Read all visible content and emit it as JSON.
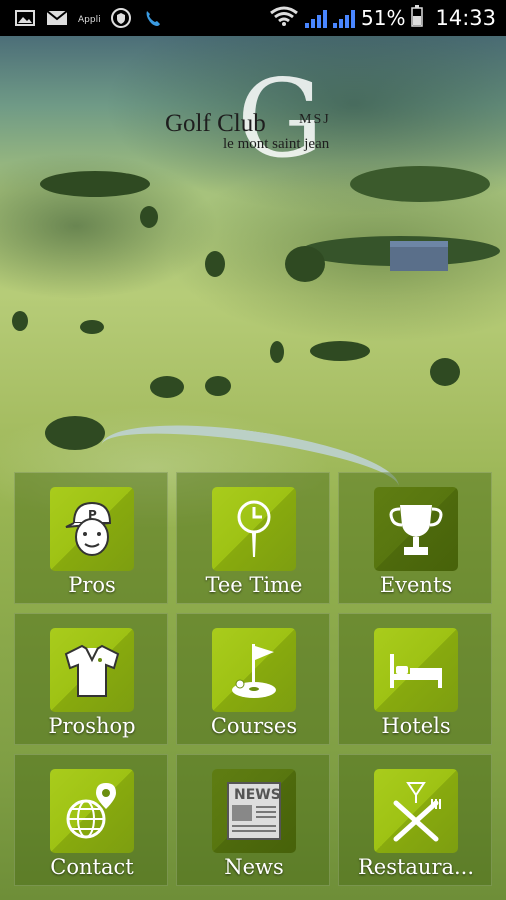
{
  "status_bar": {
    "battery": "51%",
    "time": "14:33",
    "icons": [
      "image-icon",
      "mail-icon",
      "app-icon",
      "shield-icon",
      "phone-icon",
      "wifi-icon",
      "signal-icon",
      "signal-icon",
      "battery-icon"
    ]
  },
  "logo": {
    "title": "Golf Club",
    "letter": "G",
    "initials": "MSJ",
    "subtitle": "le mont saint jean"
  },
  "menu": [
    {
      "label": "Pros",
      "icon": "golfer-face-icon"
    },
    {
      "label": "Tee Time",
      "icon": "tee-clock-icon"
    },
    {
      "label": "Events",
      "icon": "trophy-icon"
    },
    {
      "label": "Proshop",
      "icon": "polo-shirt-icon"
    },
    {
      "label": "Courses",
      "icon": "flag-hole-icon"
    },
    {
      "label": "Hotels",
      "icon": "bed-icon"
    },
    {
      "label": "Contact",
      "icon": "globe-pin-icon"
    },
    {
      "label": "News",
      "icon": "newspaper-icon"
    },
    {
      "label": "Restaura...",
      "icon": "cutlery-glass-icon"
    }
  ],
  "news_icon_text": "NEWS",
  "colors": {
    "tile_icon_bright": "#9ec214",
    "tile_icon_dark": "#58760f",
    "tile_bg": "#46691466"
  }
}
